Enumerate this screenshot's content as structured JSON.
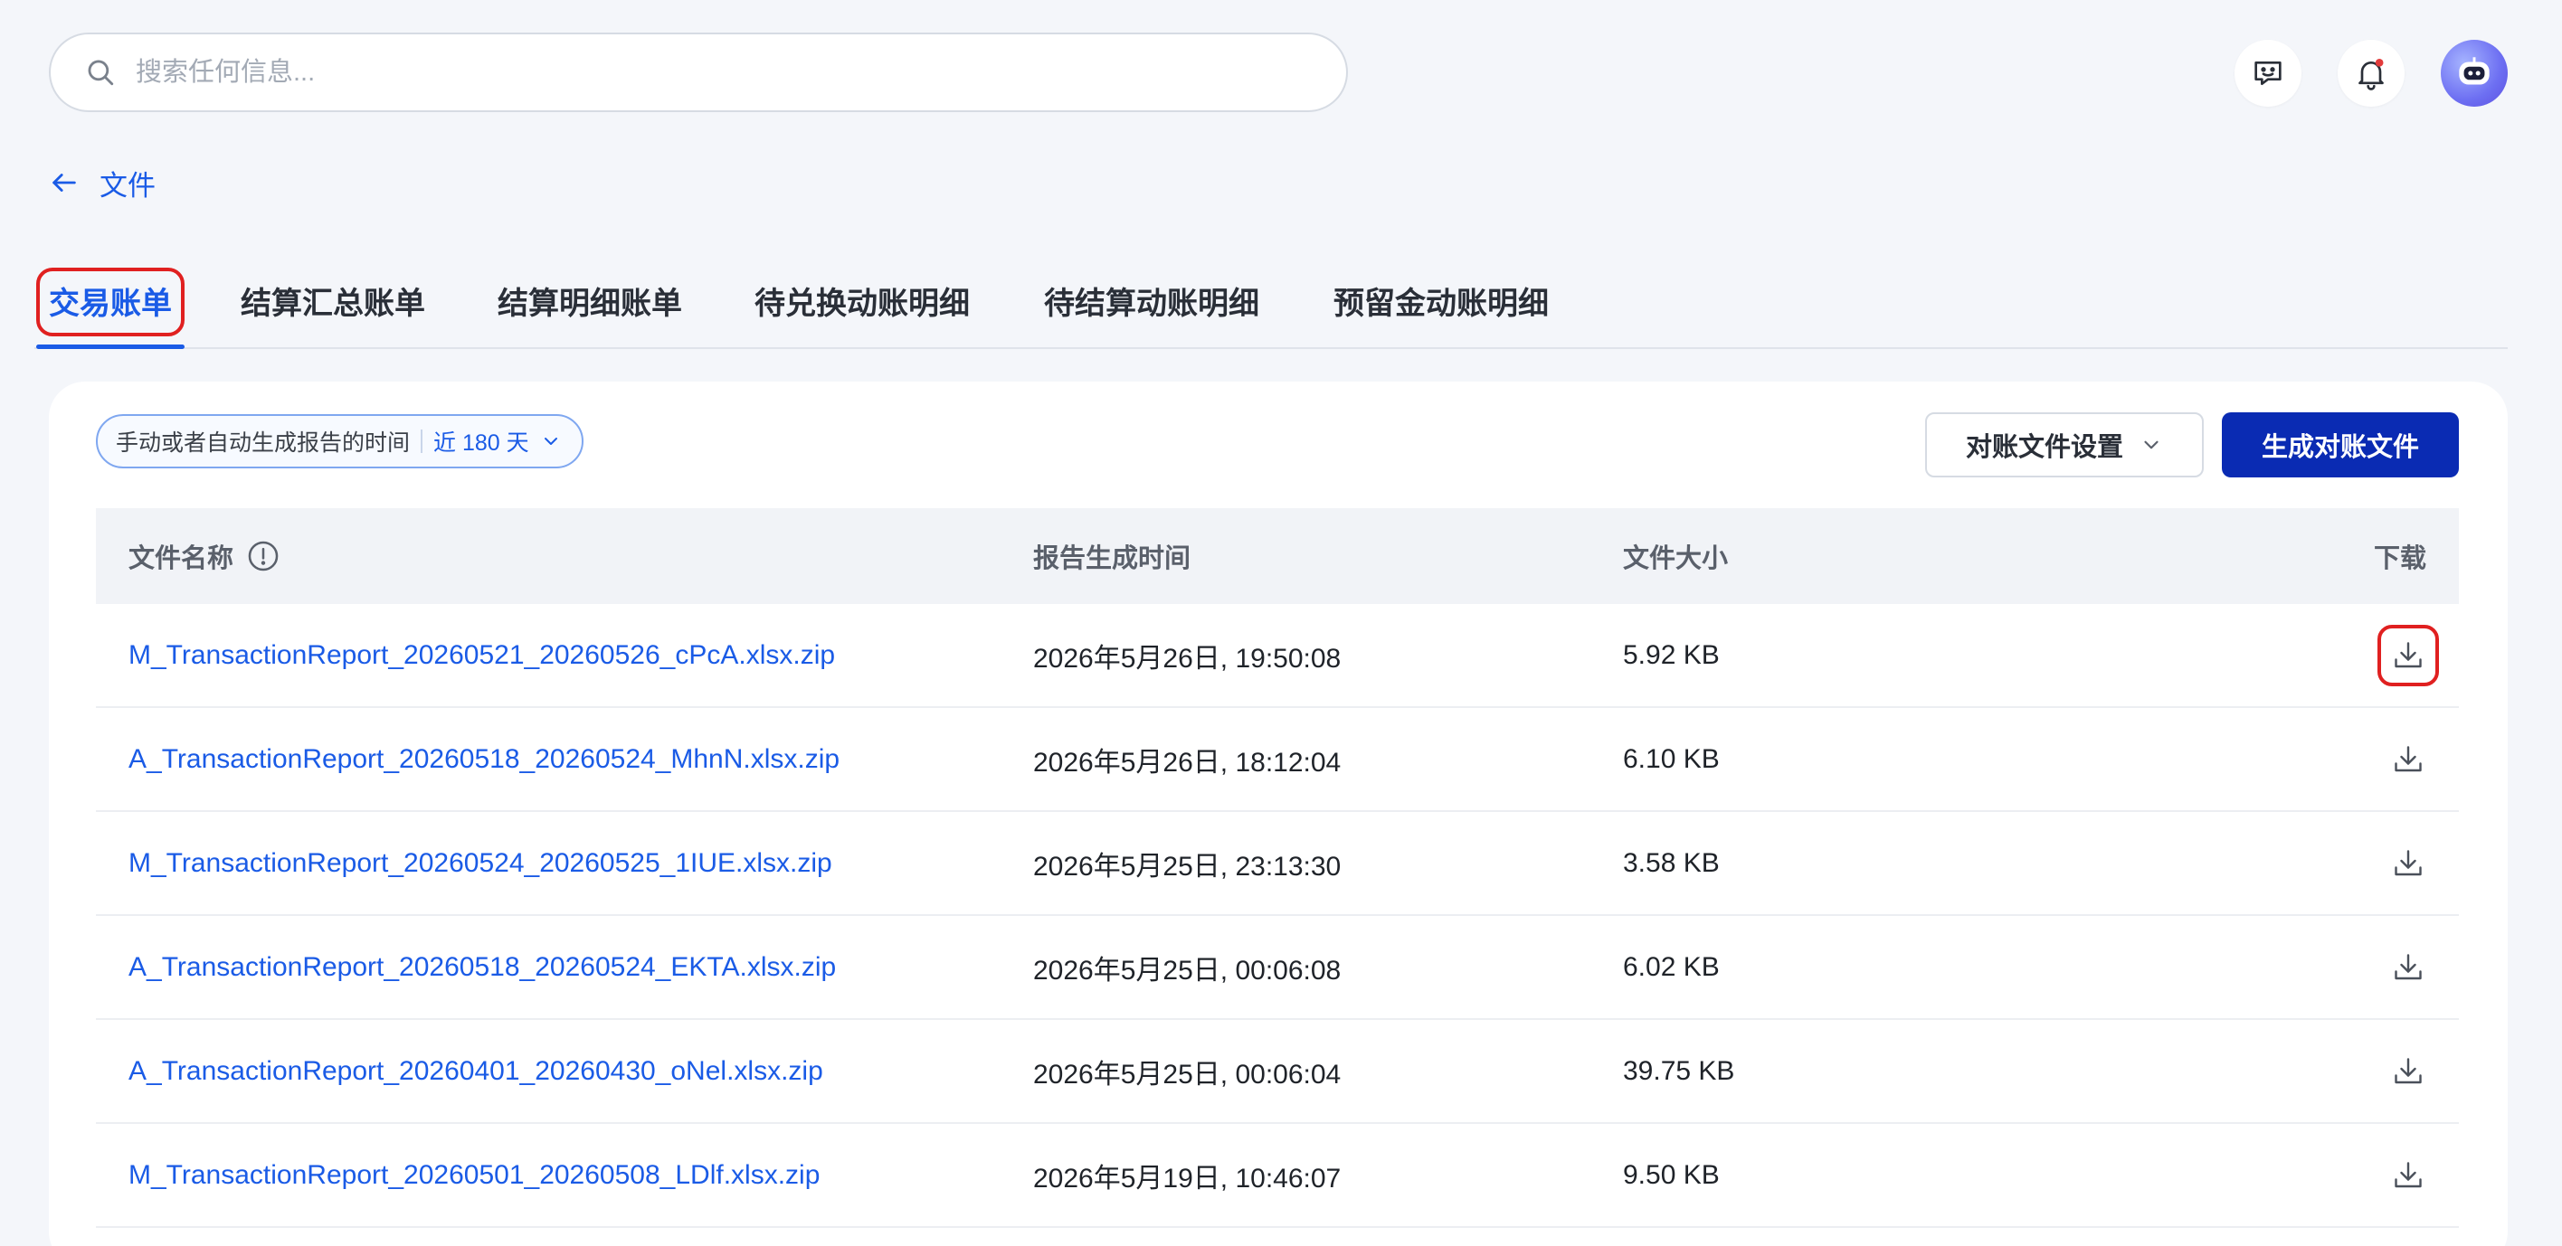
{
  "search": {
    "placeholder": "搜索任何信息..."
  },
  "header": {
    "icons": [
      "chat-bot-icon",
      "bell-icon",
      "avatar"
    ],
    "notification_dot_color": "#e23b3b"
  },
  "back": {
    "label": "文件"
  },
  "tabs": [
    {
      "label": "交易账单",
      "active": true
    },
    {
      "label": "结算汇总账单"
    },
    {
      "label": "结算明细账单"
    },
    {
      "label": "待兑换动账明细"
    },
    {
      "label": "待结算动账明细"
    },
    {
      "label": "预留金动账明细"
    }
  ],
  "filter": {
    "label": "手动或者自动生成报告的时间",
    "value": "近 180 天"
  },
  "actions": {
    "settings_label": "对账文件设置",
    "generate_label": "生成对账文件"
  },
  "table": {
    "columns": [
      "文件名称",
      "报告生成时间",
      "文件大小",
      "下载"
    ],
    "rows": [
      {
        "name": "M_TransactionReport_20260521_20260526_cPcA.xlsx.zip",
        "time": "2026年5月26日, 19:50:08",
        "size": "5.92 KB"
      },
      {
        "name": "A_TransactionReport_20260518_20260524_MhnN.xlsx.zip",
        "time": "2026年5月26日, 18:12:04",
        "size": "6.10 KB"
      },
      {
        "name": "M_TransactionReport_20260524_20260525_1IUE.xlsx.zip",
        "time": "2026年5月25日, 23:13:30",
        "size": "3.58 KB"
      },
      {
        "name": "A_TransactionReport_20260518_20260524_EKTA.xlsx.zip",
        "time": "2026年5月25日, 00:06:08",
        "size": "6.02 KB"
      },
      {
        "name": "A_TransactionReport_20260401_20260430_oNel.xlsx.zip",
        "time": "2026年5月25日, 00:06:04",
        "size": "39.75 KB"
      },
      {
        "name": "M_TransactionReport_20260501_20260508_LDlf.xlsx.zip",
        "time": "2026年5月19日, 10:46:07",
        "size": "9.50 KB"
      }
    ]
  },
  "colors": {
    "accent": "#1a5be6",
    "primary_button": "#0a2bb3",
    "highlight": "#e02020"
  }
}
